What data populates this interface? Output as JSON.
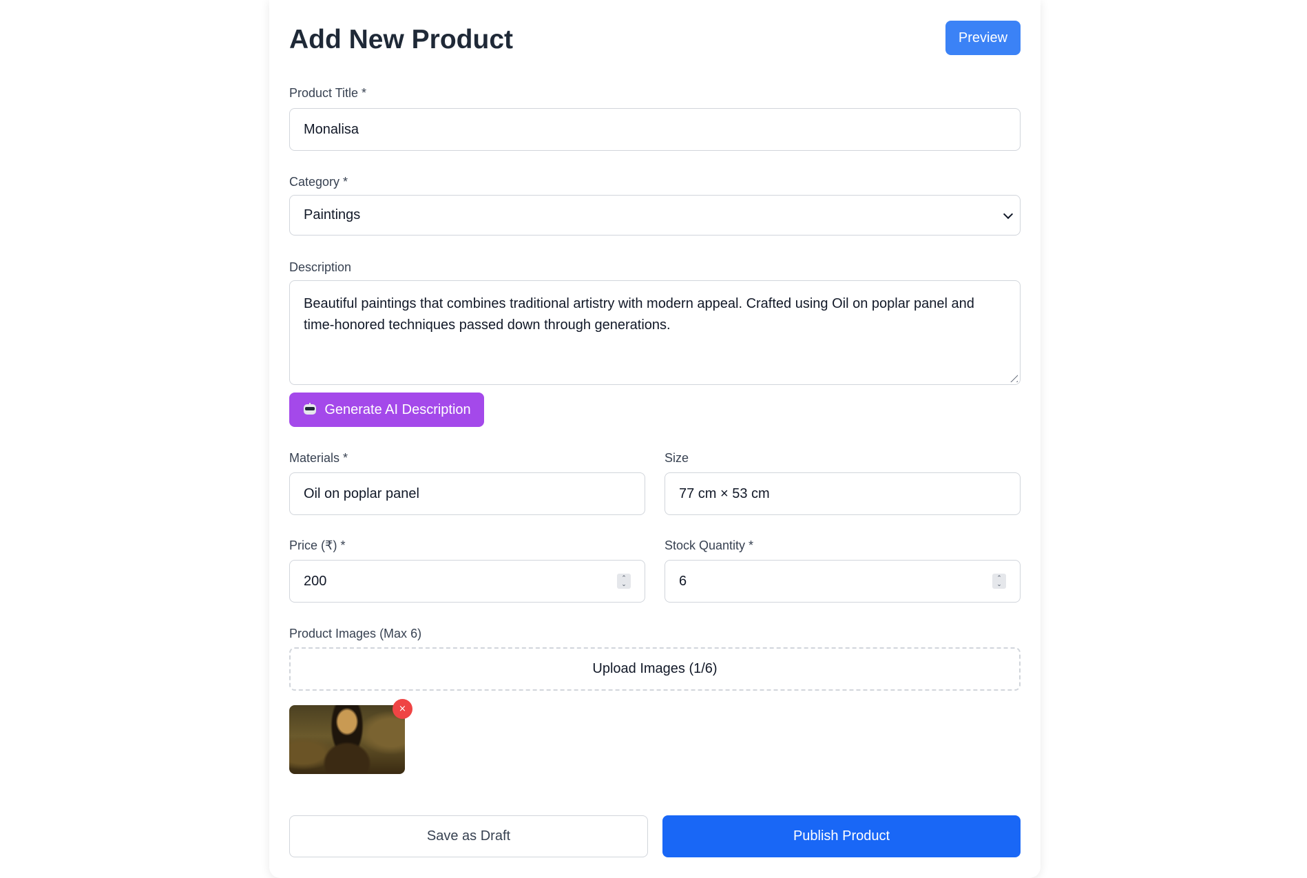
{
  "header": {
    "title": "Add New Product",
    "preview_label": "Preview"
  },
  "form": {
    "title": {
      "label": "Product Title *",
      "value": "Monalisa"
    },
    "category": {
      "label": "Category *",
      "value": "Paintings"
    },
    "description": {
      "label": "Description",
      "value": "Beautiful paintings that combines traditional artistry with modern appeal. Crafted using Oil on poplar panel and time-honored techniques passed down through generations."
    },
    "ai_button_label": "Generate AI Description",
    "materials": {
      "label": "Materials *",
      "value": "Oil on poplar panel"
    },
    "size": {
      "label": "Size",
      "value": "77 cm × 53 cm"
    },
    "price": {
      "label": "Price (₹) *",
      "value": "200"
    },
    "stock": {
      "label": "Stock Quantity *",
      "value": "6"
    },
    "images": {
      "label": "Product Images (Max 6)",
      "upload_label": "Upload Images (1/6)",
      "remove_glyph": "×"
    }
  },
  "actions": {
    "draft_label": "Save as Draft",
    "publish_label": "Publish Product"
  },
  "colors": {
    "preview": "#3b82f6",
    "ai_button": "#a449ea",
    "publish": "#1967f6",
    "remove": "#ef4444"
  },
  "icons": {
    "ai_button": "robot-icon",
    "category_dropdown": "chevron-down-icon",
    "number_spinner": "spinner-arrows-icon",
    "image_remove": "close-icon"
  }
}
